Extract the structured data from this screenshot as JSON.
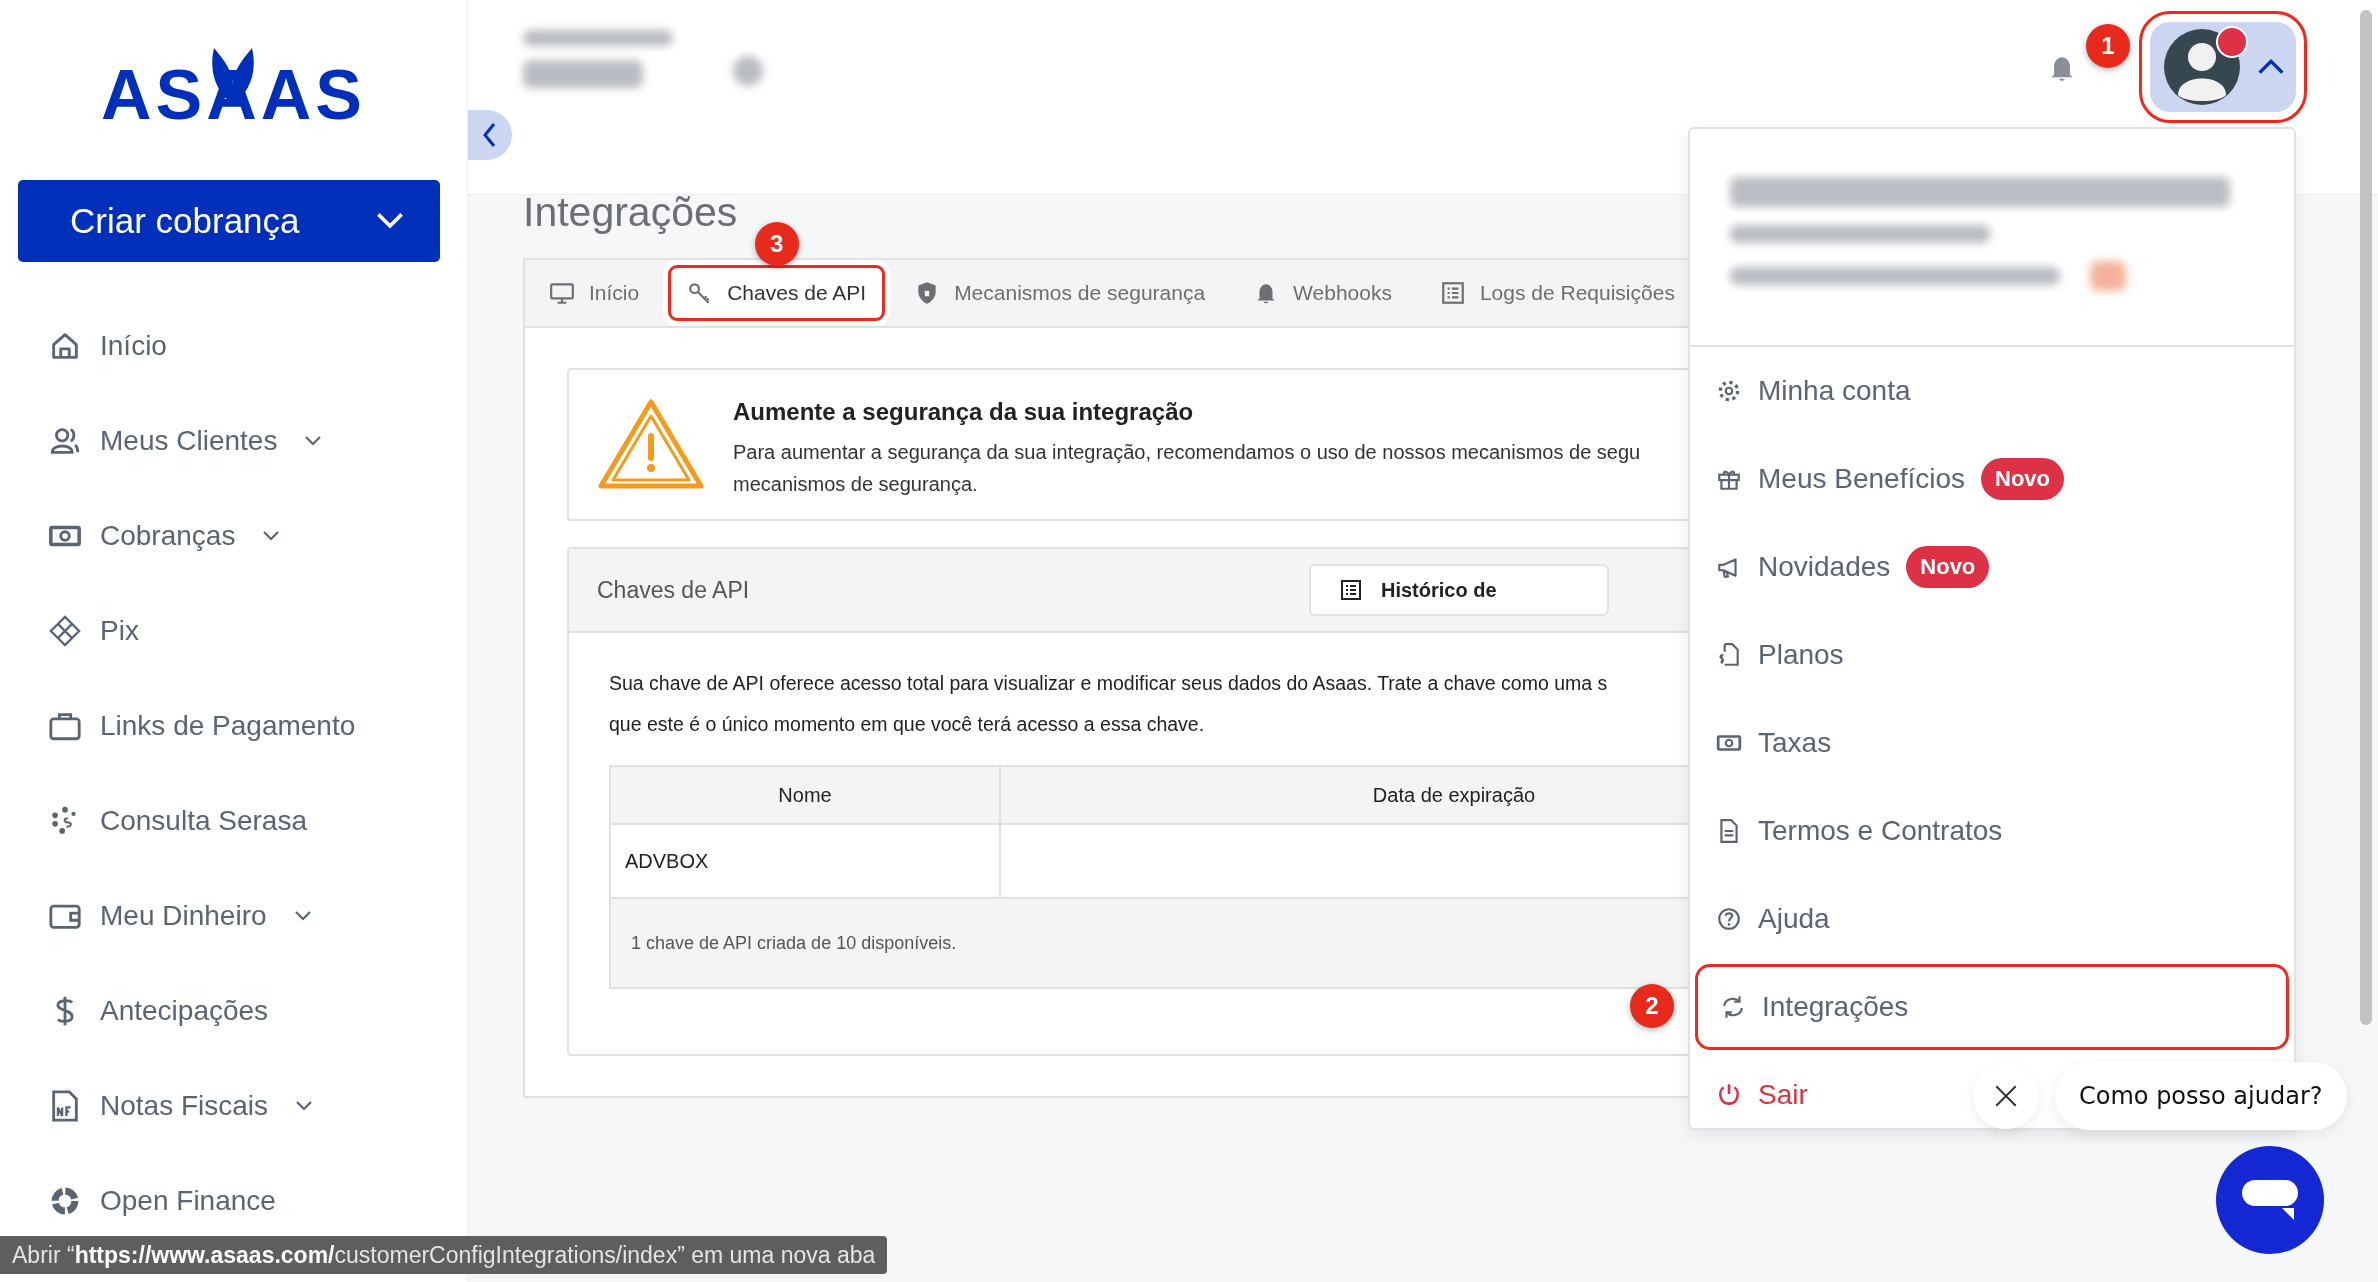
{
  "sidebar": {
    "logo": "ASAAS",
    "create_button": "Criar cobrança",
    "items": [
      {
        "label": "Início",
        "expandable": false
      },
      {
        "label": "Meus Clientes",
        "expandable": true
      },
      {
        "label": "Cobranças",
        "expandable": true
      },
      {
        "label": "Pix",
        "expandable": false
      },
      {
        "label": "Links de Pagamento",
        "expandable": false
      },
      {
        "label": "Consulta Serasa",
        "expandable": false
      },
      {
        "label": "Meu Dinheiro",
        "expandable": true
      },
      {
        "label": "Antecipações",
        "expandable": false
      },
      {
        "label": "Notas Fiscais",
        "expandable": true
      },
      {
        "label": "Open Finance",
        "expandable": false
      }
    ]
  },
  "header": {
    "avatar_button": {
      "expanded": true,
      "alert": true,
      "highlighted": true,
      "step": "1"
    }
  },
  "page": {
    "title": "Integrações",
    "tabs": [
      {
        "label": "Início",
        "selected": false,
        "highlighted": false
      },
      {
        "label": "Chaves de API",
        "selected": true,
        "highlighted": true,
        "step": "3"
      },
      {
        "label": "Mecanismos de segurança",
        "selected": false,
        "highlighted": false
      },
      {
        "label": "Webhooks",
        "selected": false,
        "highlighted": false
      },
      {
        "label": "Logs de Requisições",
        "selected": false,
        "highlighted": false
      }
    ],
    "alert": {
      "title": "Aumente a segurança da sua integração",
      "text_lines": [
        "Para aumentar a segurança da sua integração, recomendamos o uso de nossos mecanismos de segu",
        "mecanismos de segurança."
      ]
    },
    "api_keys": {
      "title": "Chaves de API",
      "history_button": "Histórico de",
      "description_lines": [
        "Sua chave de API oferece acesso total para visualizar e modificar seus dados do Asaas. Trate a chave como uma s",
        "que este é o único momento em que você terá acesso a essa chave."
      ],
      "table": {
        "columns": [
          "Nome",
          "Data de expiração"
        ],
        "rows": [
          {
            "cells": [
              "ADVBOX"
            ]
          }
        ],
        "footer": "1 chave de API criada de 10 disponíveis."
      }
    }
  },
  "user_menu": {
    "items": [
      {
        "label": "Minha conta",
        "kind": "normal",
        "highlighted": false
      },
      {
        "label": "Meus Benefícios",
        "kind": "normal",
        "badge": "Novo",
        "highlighted": false
      },
      {
        "label": "Novidades",
        "kind": "normal",
        "badge": "Novo",
        "highlighted": false
      },
      {
        "label": "Planos",
        "kind": "normal",
        "highlighted": false
      },
      {
        "label": "Taxas",
        "kind": "normal",
        "highlighted": false
      },
      {
        "label": "Termos e Contratos",
        "kind": "normal",
        "highlighted": false
      },
      {
        "label": "Ajuda",
        "kind": "normal",
        "highlighted": false
      },
      {
        "label": "Integrações",
        "kind": "normal",
        "highlighted": true,
        "step": "2"
      },
      {
        "label": "Sair",
        "kind": "logout",
        "highlighted": false
      }
    ]
  },
  "chat": {
    "prompt": "Como posso ajudar?"
  },
  "status_bar": {
    "text": "Abrir “**https://www.asaas.com/**customerConfigIntegrations/index” em uma nova aba"
  }
}
